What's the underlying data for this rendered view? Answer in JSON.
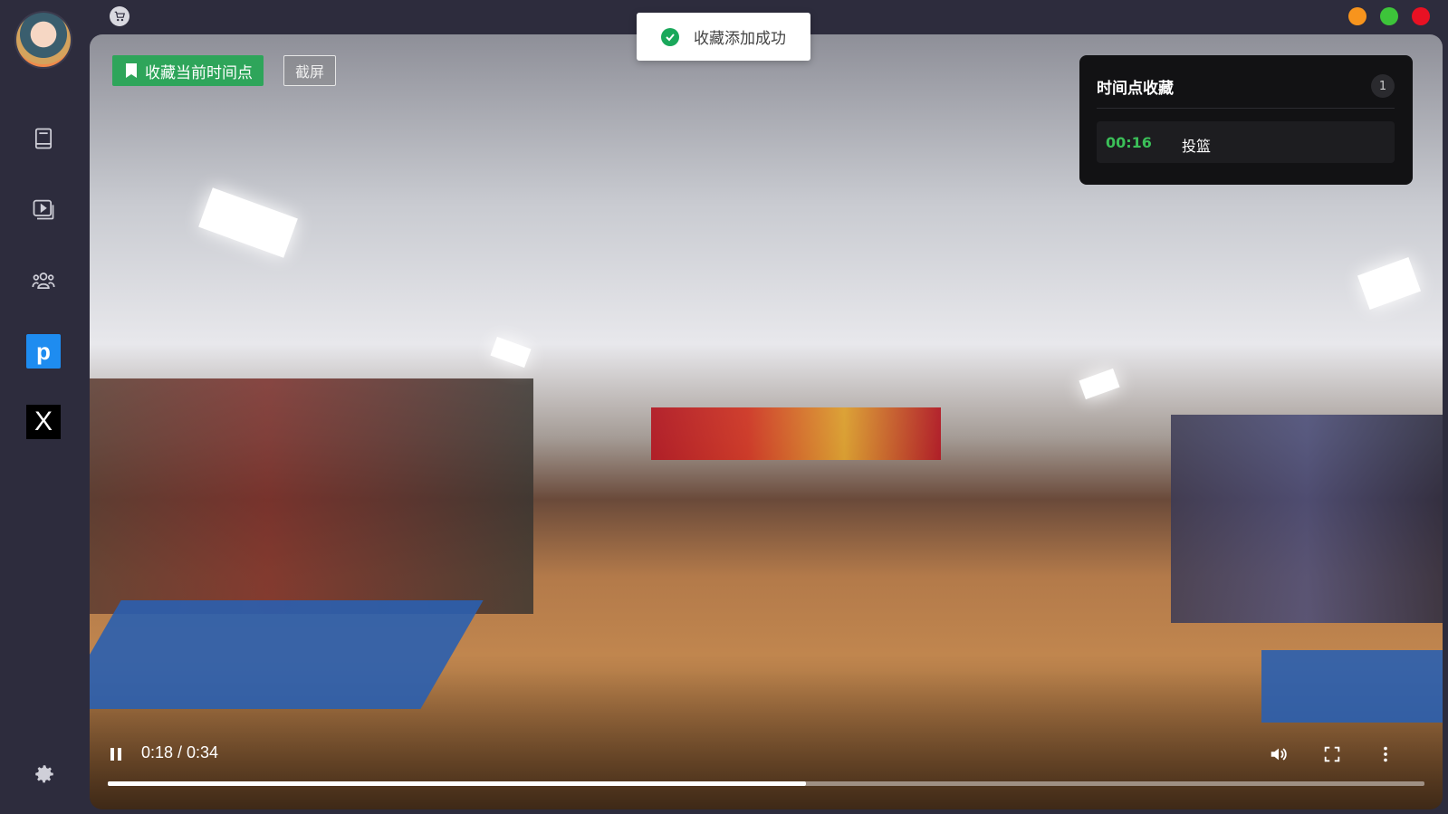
{
  "sidebar": {
    "avatar": "avatar",
    "items": [
      {
        "icon": "book-icon"
      },
      {
        "icon": "video-icon"
      },
      {
        "icon": "community-icon"
      },
      {
        "icon": "p-brand-icon",
        "label": "p"
      },
      {
        "icon": "x-brand-icon",
        "label": "X"
      }
    ],
    "settings_icon": "gear-icon"
  },
  "topbar": {
    "cart_icon": "cart-icon",
    "window_controls": {
      "minimize": "#f7941d",
      "maximize": "#3dc43a",
      "close": "#e81123"
    }
  },
  "toast": {
    "message": "收藏添加成功",
    "icon": "check-circle-icon"
  },
  "video": {
    "favorite_button": "收藏当前时间点",
    "screenshot_button": "截屏",
    "panel": {
      "title": "时间点收藏",
      "count": "1",
      "items": [
        {
          "time": "00:16",
          "label": "投篮"
        }
      ]
    },
    "controls": {
      "time": "0:18 / 0:34",
      "progress": 0.53
    }
  },
  "colors": {
    "accent_green": "#2ea55a",
    "bg": "#2d2c3d"
  }
}
